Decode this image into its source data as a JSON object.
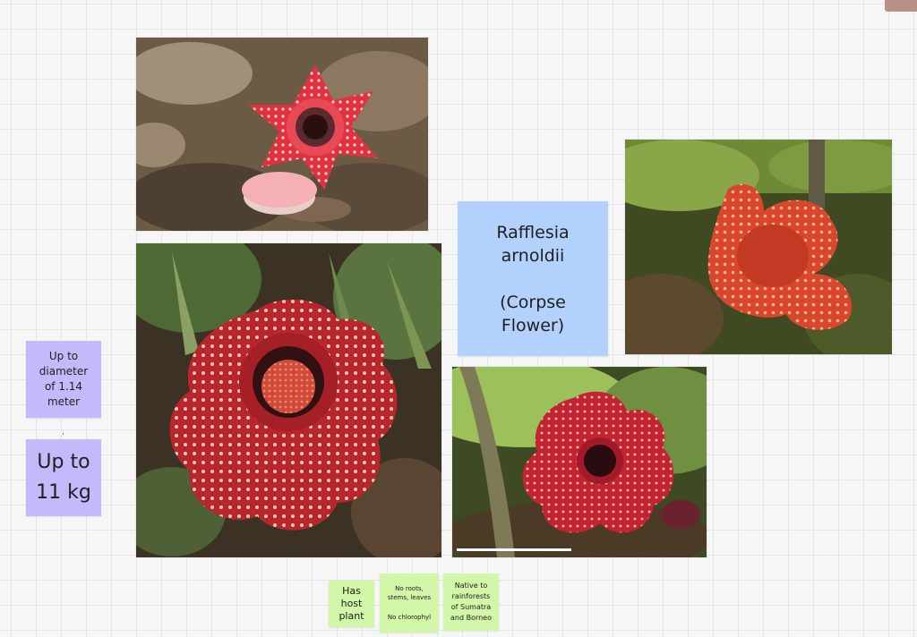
{
  "board": {
    "title_note": "Rafflesia\narnoldii\n\n(Corpse\nFlower)",
    "diameter_note": "Up to\ndiameter\nof 1.14\nmeter",
    "weight_note": "Up to\n11 kg",
    "host_note": "Has\nhost\nplant",
    "roots_note_line1": "No roots,\nstems, leaves",
    "roots_note_line2": "No chlorophyl",
    "native_note": "Native to\nrainforests\nof Sumatra\nand Borneo"
  },
  "photos": [
    {
      "name": "small red rafflesia bud photo"
    },
    {
      "name": "large rafflesia top view photo"
    },
    {
      "name": "rafflesia in forest photo"
    },
    {
      "name": "rafflesia with measuring scale photo"
    }
  ],
  "colors": {
    "blue_sticky": "#b3d1fd",
    "purple_sticky": "#c6b9fb",
    "green_sticky": "#d2f7a8",
    "flower_red": "#c9302c"
  }
}
